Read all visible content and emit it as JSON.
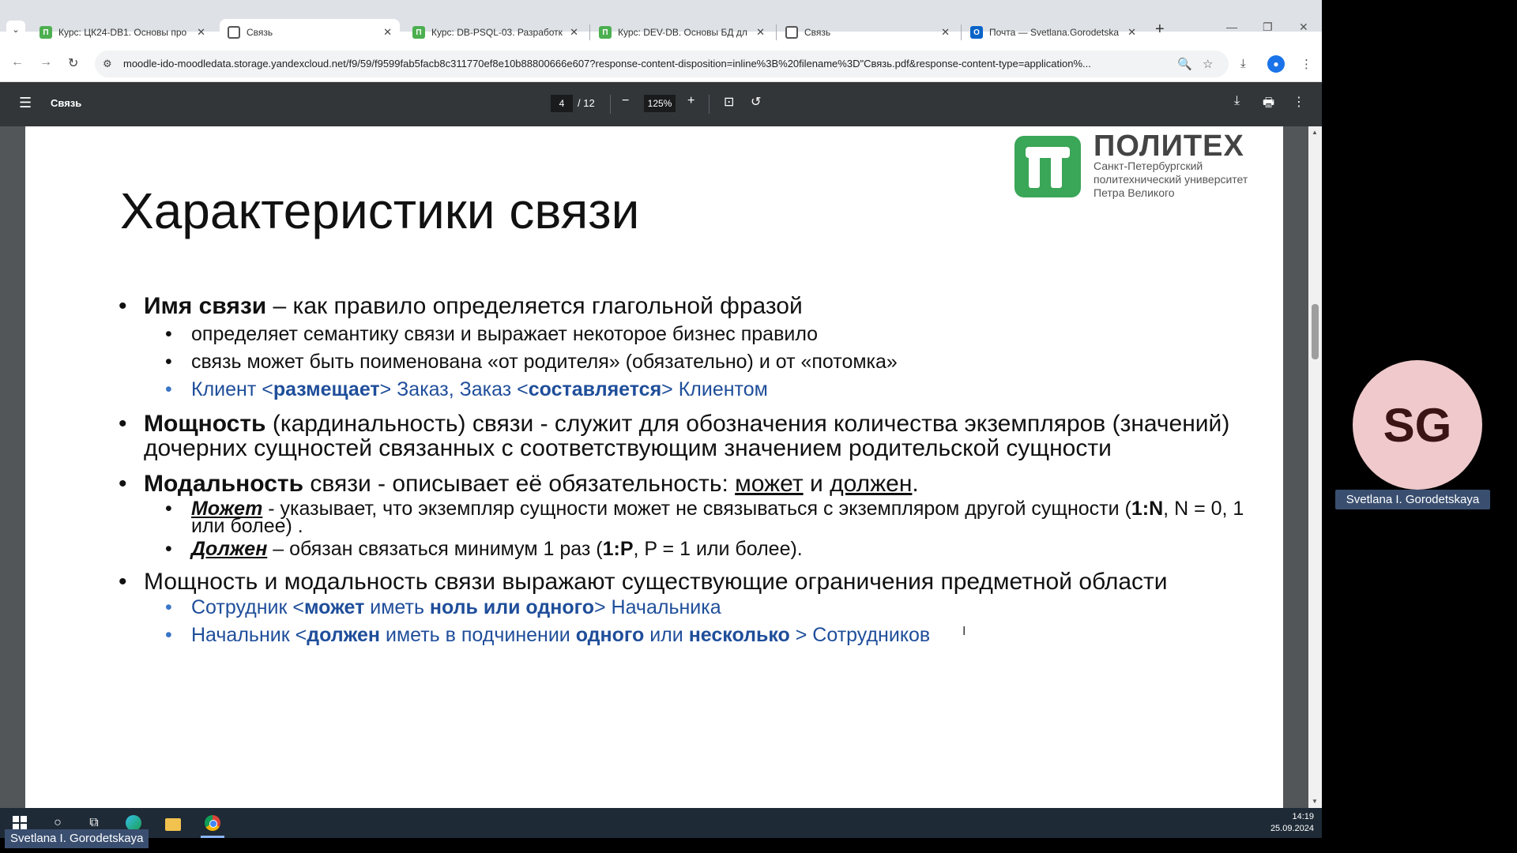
{
  "browser": {
    "tabs": [
      {
        "label": "Курс: ЦК24-DB1. Основы про",
        "favicon": "moodle-icon",
        "active": false
      },
      {
        "label": "Связь",
        "favicon": "globe-icon",
        "active": true
      },
      {
        "label": "Курс: DB-PSQL-03. Разработк",
        "favicon": "moodle-icon",
        "active": false
      },
      {
        "label": "Курс: DEV-DB. Основы БД дл",
        "favicon": "moodle-icon",
        "active": false
      },
      {
        "label": "Связь",
        "favicon": "globe-icon",
        "active": false
      },
      {
        "label": "Почта — Svetlana.Gorodetska",
        "favicon": "outlook-icon",
        "active": false
      }
    ],
    "url": "moodle-ido-moodledata.storage.yandexcloud.net/f9/59/f9599fab5facb8c311770ef8e10b88800666e607?response-content-disposition=inline%3B%20filename%3D\"Связь.pdf&response-content-type=application%...",
    "close_glyph": "✕",
    "new_tab_glyph": "+"
  },
  "pdf_viewer": {
    "title": "Связь",
    "current_page": "4",
    "total_pages": "/ 12",
    "zoom": "125%"
  },
  "slide": {
    "logo_name": "ПОЛИТЕХ",
    "logo_sub_1": "Санкт-Петербургский",
    "logo_sub_2": "политехнический университет",
    "logo_sub_3": "Петра Великого",
    "title": "Характеристики связи",
    "b1": {
      "bold": "Имя связи",
      "rest": " – как правило определяется глагольной фразой"
    },
    "b1_s1": "определяет семантику связи и выражает некоторое бизнес правило",
    "b1_s2": "связь может быть поименована «от родителя» (обязательно) и от «потомка»",
    "b1_s3": {
      "p1": "Клиент <",
      "b1": "размещает",
      "p2": "> Заказ, Заказ <",
      "b2": "составляется",
      "p3": "> Клиентом"
    },
    "b2": {
      "bold": "Мощность",
      "rest": " (кардинальность) связи - служит для обозначения количества экземпляров (значений) дочерних сущностей связанных с соответствующим значением родительской сущности"
    },
    "b3": {
      "bold": "Модальность",
      "rest": " связи - описывает её обязательность: ",
      "u1": "может",
      "mid": " и ",
      "u2": "должен",
      "end": "."
    },
    "b3_s1": {
      "bi": "Может",
      "p1": " - указывает, что экземпляр сущности может не связываться с экземпляром другой сущности (",
      "b": "1:N",
      "p2": ", N = 0, 1 или более) ."
    },
    "b3_s2": {
      "bi": "Должен",
      "p1": " – обязан связаться минимум 1 раз (",
      "b": "1:P",
      "p2": ", P = 1 или более)."
    },
    "b4": "Мощность и модальность связи выражают существующие ограничения предметной области",
    "b4_s1": {
      "p1": "Сотрудник <",
      "b1": "может",
      "p2": " иметь ",
      "b2": "ноль или одного",
      "p3": "> Начальника"
    },
    "b4_s2": {
      "p1": "Начальник <",
      "b1": "должен",
      "p2": " иметь в подчинении ",
      "b2": "одного",
      "p3": " или ",
      "b3": "несколько",
      "p4": " > Сотрудников"
    }
  },
  "taskbar": {
    "time": "14:19",
    "date": "25.09.2024"
  },
  "meeting": {
    "avatar_initials": "SG",
    "presenter_name": "Svetlana I. Gorodetskaya",
    "self_name": "Svetlana I. Gorodetskaya"
  },
  "colors": {
    "accent_blue": "#1f4e9a",
    "pdf_toolbar": "#323639",
    "logo_green": "#3aa657",
    "avatar_bg": "#efc9cb"
  }
}
